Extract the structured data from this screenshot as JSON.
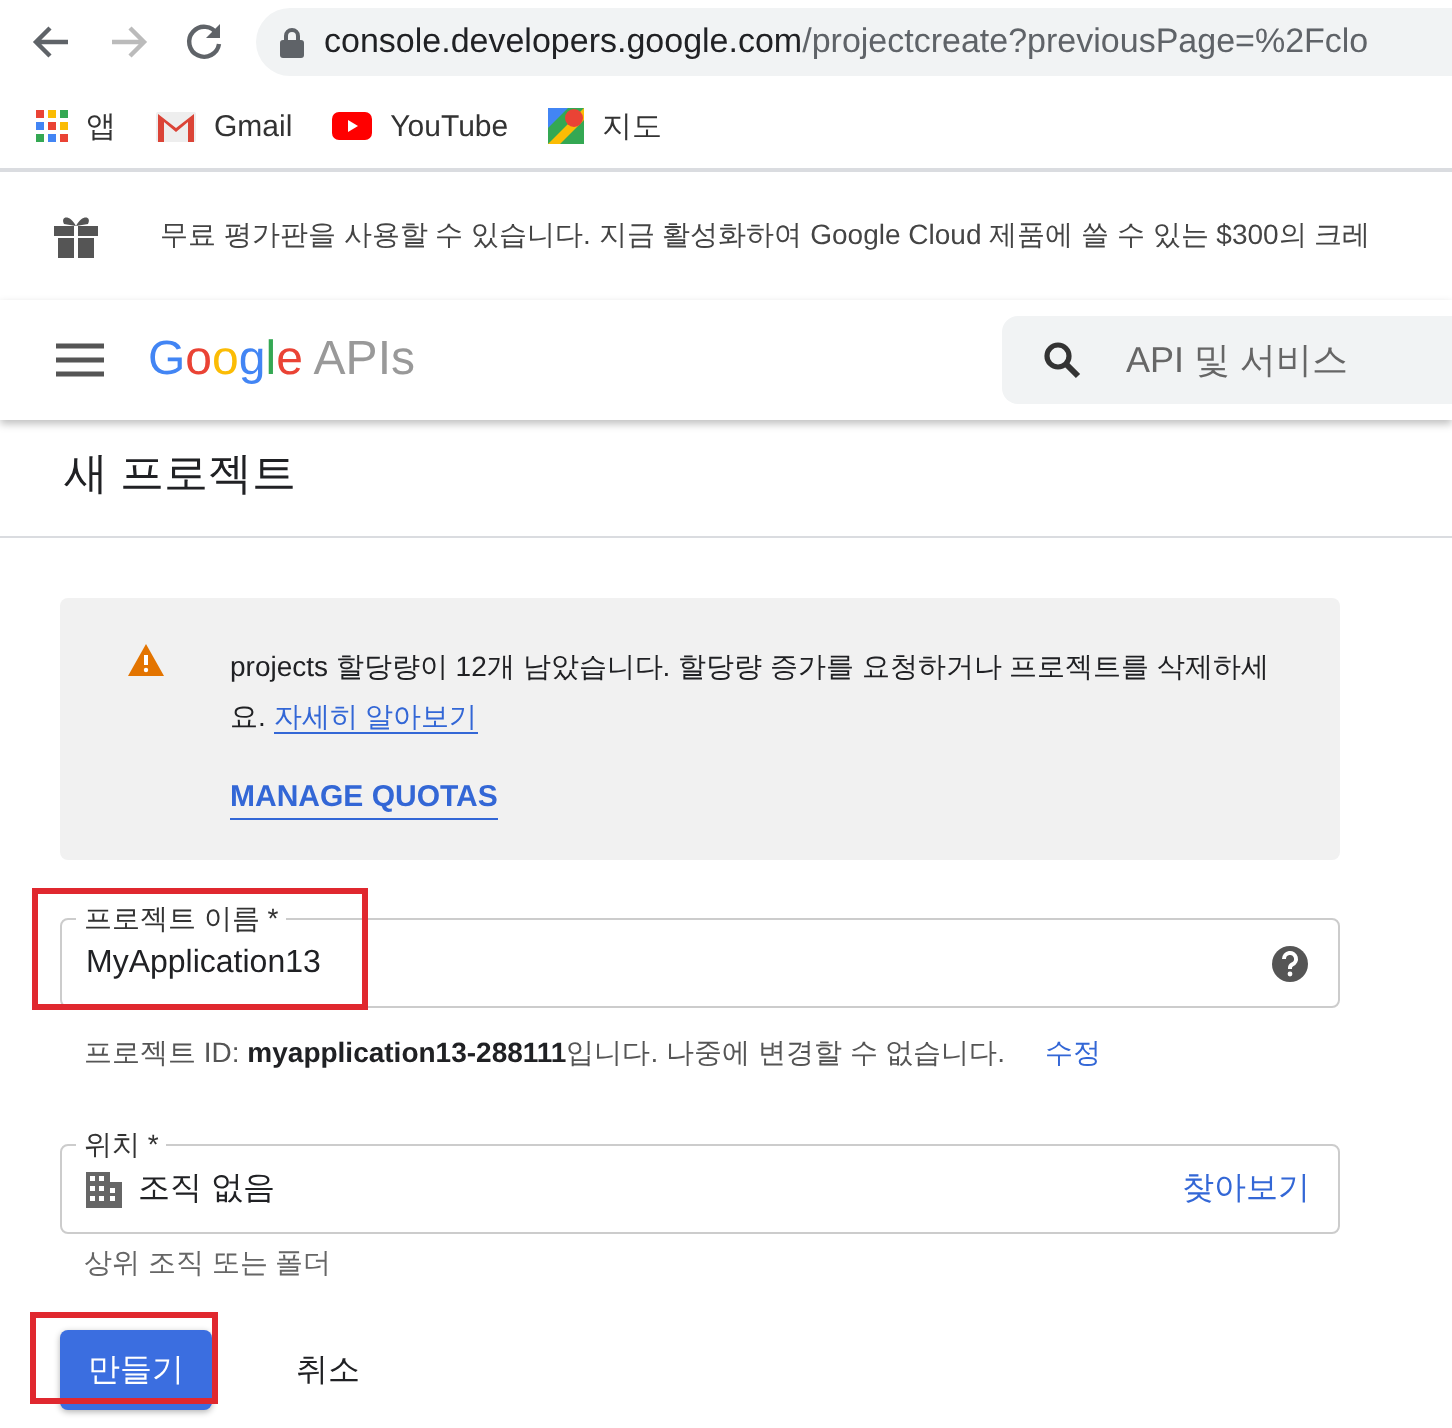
{
  "browser": {
    "url_host": "console.developers.google.com",
    "url_path": "/projectcreate?previousPage=%2Fclo",
    "back_disabled": false,
    "forward_disabled": true
  },
  "bookmarks": [
    {
      "kind": "apps",
      "label": "앱"
    },
    {
      "kind": "mail",
      "label": "Gmail"
    },
    {
      "kind": "video",
      "label": "YouTube"
    },
    {
      "kind": "maps",
      "label": "지도"
    }
  ],
  "trial_banner": "무료 평가판을 사용할 수 있습니다. 지금 활성화하여 Google Cloud 제품에 쓸 수 있는 $300의 크레",
  "header": {
    "logo_brand": "Google",
    "logo_product": "APIs",
    "search": {
      "placeholder": "API 및 서비스"
    }
  },
  "page_title": "새 프로젝트",
  "quota_notice": {
    "text": "projects 할당량이 12개 남았습니다. 할당량 증가를 요청하거나 프로젝트를 삭제하세요.",
    "link": "자세히 알아보기",
    "action": "MANAGE QUOTAS"
  },
  "project_name": {
    "label": "프로젝트 이름 *",
    "value": "MyApplication13",
    "highlighted": true
  },
  "project_id_note": {
    "prefix": "프로젝트 ID: ",
    "id": "myapplication13-288111",
    "suffix": "입니다. 나중에 변경할 수 없습니다.",
    "edit_link": "수정"
  },
  "location": {
    "label": "위치 *",
    "value": "조직 없음",
    "browse": "찾아보기",
    "helper": "상위 조직 또는 폴더"
  },
  "buttons": [
    {
      "kind": "primary",
      "label": "만들기",
      "highlighted": true
    },
    {
      "kind": "text",
      "label": "취소",
      "highlighted": false
    }
  ]
}
